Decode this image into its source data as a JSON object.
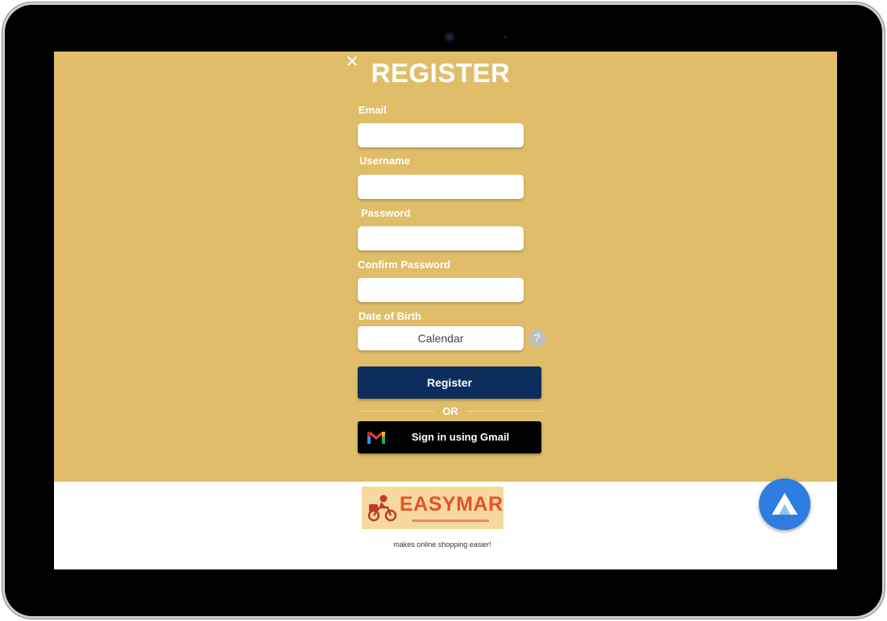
{
  "register_form": {
    "title": "REGISTER",
    "close_icon": "close-icon",
    "fields": [
      {
        "label": "Email",
        "value": "",
        "placeholder": ""
      },
      {
        "label": "Username",
        "value": "",
        "placeholder": ""
      },
      {
        "label": "Password",
        "value": "",
        "placeholder": ""
      },
      {
        "label": "Confirm Password",
        "value": "",
        "placeholder": ""
      }
    ],
    "dob_label": "Date of Birth",
    "calendar_label": "Calendar",
    "help_icon": "?",
    "register_button": "Register",
    "or_text": "OR",
    "gmail_button": "Sign in using Gmail",
    "gmail_icon": "gmail-icon"
  },
  "footer": {
    "brand_name": "EASYMART",
    "tagline": "makes online shopping easier!",
    "app_icon": "app-launcher-icon"
  },
  "colors": {
    "background": "#e0be69",
    "register_button": "#0d2e5c",
    "gmail_button": "#000000",
    "brand": "#e8512a",
    "fab": "#2e7ce0"
  }
}
